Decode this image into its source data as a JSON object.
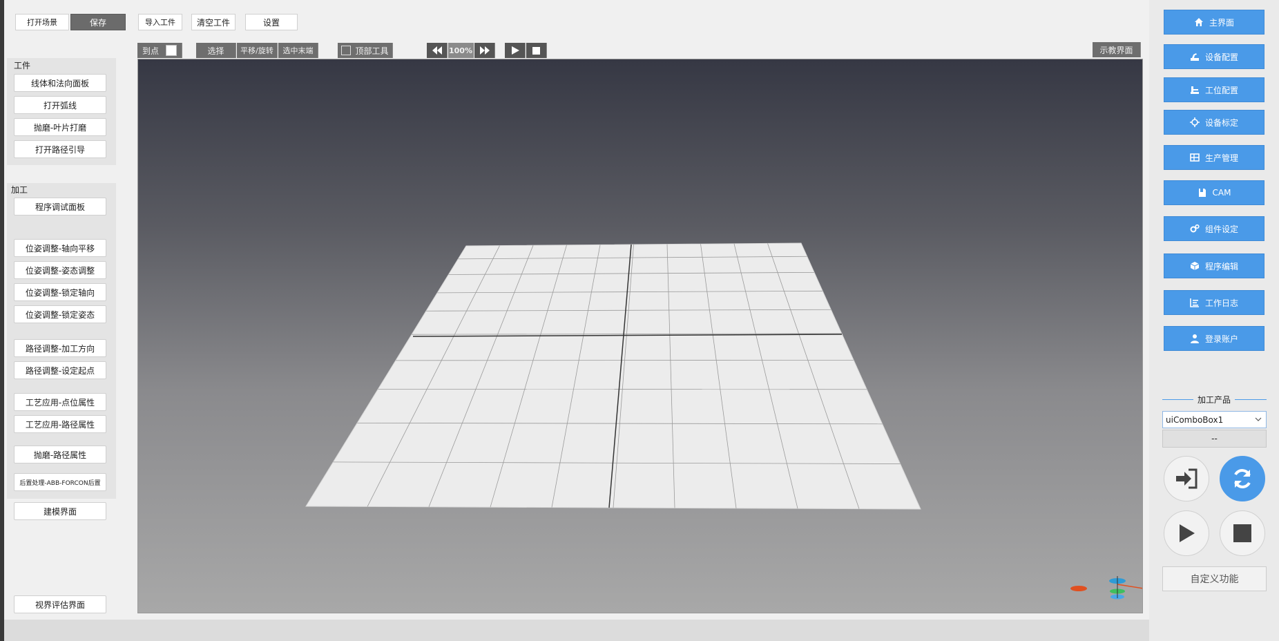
{
  "toolbar": {
    "open_scene": "打开场景",
    "save": "保存",
    "import_workpiece": "导入工件",
    "clear_workpiece": "清空工件",
    "settings": "设置"
  },
  "workpiece_panel": {
    "title": "工件",
    "buttons": [
      "线体和法向面板",
      "打开弧线",
      "抛磨-叶片打磨",
      "打开路径引导"
    ]
  },
  "process_panel": {
    "title": "加工",
    "buttons": [
      "程序调试面板",
      "位姿调整-轴向平移",
      "位姿调整-姿态调整",
      "位姿调整-锁定轴向",
      "位姿调整-锁定姿态",
      "路径调整-加工方向",
      "路径调整-设定起点",
      "工艺应用-点位属性",
      "工艺应用-路径属性",
      "抛磨-路径属性",
      "后置处理-ABB-FORCON后置",
      "建模界面"
    ]
  },
  "view_assess": "视界评估界面",
  "viewport_toolbar": {
    "to_point": "到点",
    "select": "选择",
    "translate_rotate": "平移/旋转",
    "select_end": "选中末端",
    "top_tool": "顶部工具",
    "zoom": "100%",
    "teach_view": "示教界面"
  },
  "nav": [
    {
      "label": "主界面",
      "icon": "home-icon"
    },
    {
      "label": "设备配置",
      "icon": "device-config-icon"
    },
    {
      "label": "工位配置",
      "icon": "station-config-icon"
    },
    {
      "label": "设备标定",
      "icon": "calibration-icon"
    },
    {
      "label": "生产管理",
      "icon": "table-icon"
    },
    {
      "label": "CAM",
      "icon": "cam-icon"
    },
    {
      "label": "组件设定",
      "icon": "gears-icon"
    },
    {
      "label": "程序编辑",
      "icon": "cube-icon"
    },
    {
      "label": "工作日志",
      "icon": "log-icon"
    },
    {
      "label": "登录账户",
      "icon": "user-icon"
    }
  ],
  "product": {
    "title": "加工产品",
    "combo_value": "uiComboBox1",
    "field_value": "--"
  },
  "custom_function": "自定义功能",
  "colors": {
    "accent": "#4a9ae8",
    "dark_button": "#6b6b6b",
    "viewport_top": "#363844",
    "viewport_bottom": "#a8a8a8"
  }
}
